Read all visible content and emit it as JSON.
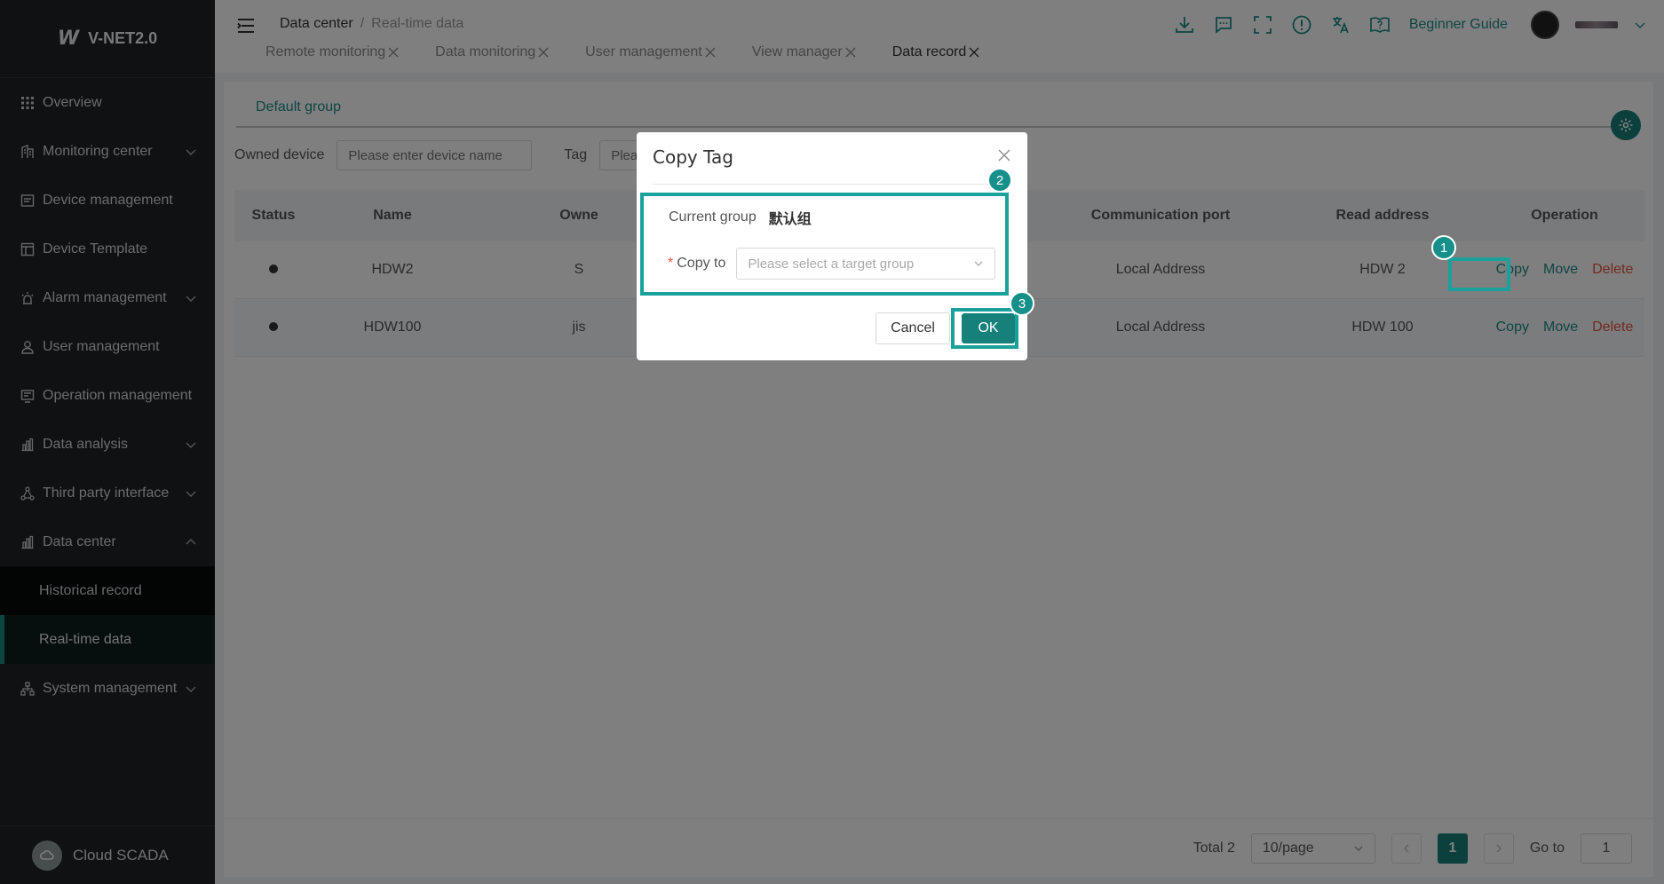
{
  "app": {
    "name": "V-NET2.0",
    "logo_mark": "W",
    "footer": "Cloud SCADA"
  },
  "sidebar": {
    "items": [
      {
        "label": "Overview",
        "icon": "grid-icon",
        "expandable": false
      },
      {
        "label": "Monitoring center",
        "icon": "building-icon",
        "expandable": true
      },
      {
        "label": "Device management",
        "icon": "device-icon",
        "expandable": false
      },
      {
        "label": "Device Template",
        "icon": "template-icon",
        "expandable": false
      },
      {
        "label": "Alarm management",
        "icon": "alarm-icon",
        "expandable": true
      },
      {
        "label": "User management",
        "icon": "user-icon",
        "expandable": false
      },
      {
        "label": "Operation management",
        "icon": "operation-icon",
        "expandable": false
      },
      {
        "label": "Data analysis",
        "icon": "bar-chart-icon",
        "expandable": true
      },
      {
        "label": "Third party interface",
        "icon": "network-icon",
        "expandable": true
      },
      {
        "label": "Data center",
        "icon": "bar-chart-icon",
        "expandable": true,
        "expanded": true
      }
    ],
    "sub_items": [
      {
        "label": "Historical record",
        "active": false
      },
      {
        "label": "Real-time data",
        "active": true
      }
    ],
    "last_item": {
      "label": "System management",
      "icon": "hierarchy-icon",
      "expandable": true
    }
  },
  "header": {
    "breadcrumb": {
      "parent": "Data center",
      "separator": "/",
      "current": "Real-time data"
    },
    "tabs": [
      {
        "label": "Remote monitoring",
        "active": false
      },
      {
        "label": "Data monitoring",
        "active": false
      },
      {
        "label": "User management",
        "active": false
      },
      {
        "label": "View manager",
        "active": false
      },
      {
        "label": "Data record",
        "active": true
      }
    ],
    "tools": [
      "download-icon",
      "chat-icon",
      "fullscreen-icon",
      "info-icon",
      "translate-icon",
      "help-book-icon"
    ],
    "guide_label": "Beginner Guide"
  },
  "content": {
    "group_tab": "Default group",
    "filters": {
      "owned_device_label": "Owned device",
      "owned_device_placeholder": "Please enter device name",
      "tag_label": "Tag",
      "tag_placeholder": "Pleas"
    },
    "columns": [
      "Status",
      "Name",
      "Owne",
      "Communication port",
      "Read address",
      "Operation"
    ],
    "rows": [
      {
        "name": "HDW2",
        "owner": "S",
        "port": "Local Address",
        "address": "HDW 2"
      },
      {
        "name": "HDW100",
        "owner": "jis",
        "port": "Local Address",
        "address": "HDW 100"
      }
    ],
    "actions": {
      "copy": "Copy",
      "move": "Move",
      "delete": "Delete"
    },
    "pager": {
      "total": "Total 2",
      "page_size": "10/page",
      "current_page": "1",
      "goto_label": "Go to",
      "goto_value": "1"
    }
  },
  "dialog": {
    "title": "Copy Tag",
    "current_group_label": "Current group",
    "current_group_value": "默认组",
    "required_mark": "*",
    "copy_to_label": "Copy to",
    "copy_to_placeholder": "Please select a target group",
    "cancel_label": "Cancel",
    "ok_label": "OK"
  },
  "annotations": [
    "1",
    "2",
    "3"
  ],
  "colors": {
    "accent": "#16807a",
    "annotation": "#1aa19c",
    "danger": "#e8553f",
    "sidebar": "#1f2326"
  }
}
